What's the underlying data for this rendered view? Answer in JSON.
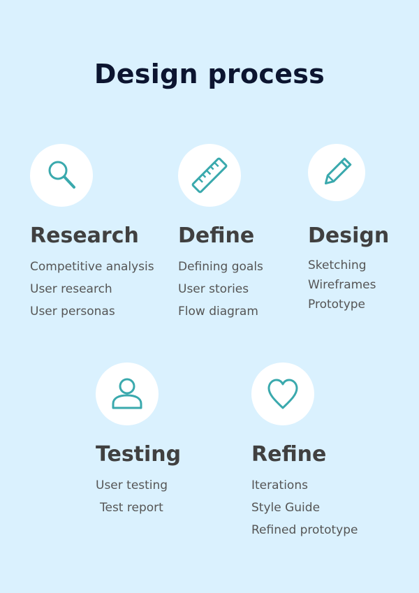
{
  "title": "Design process",
  "stages": [
    {
      "name": "Research",
      "icon": "magnifier-icon",
      "items": [
        "Competitive analysis",
        "User research",
        "User personas"
      ]
    },
    {
      "name": "Define",
      "icon": "ruler-icon",
      "items": [
        "Defining goals",
        "User stories",
        "Flow diagram"
      ]
    },
    {
      "name": "Design",
      "icon": "pencil-icon",
      "items": [
        "Sketching",
        "Wireframes",
        "Prototype"
      ]
    },
    {
      "name": "Testing",
      "icon": "user-icon",
      "items": [
        "User testing",
        "Test report"
      ]
    },
    {
      "name": "Refine",
      "icon": "heart-icon",
      "items": [
        "Iterations",
        "Style Guide",
        "Refined prototype"
      ]
    }
  ],
  "colors": {
    "background": "#daf1fe",
    "icon": "#3aa9ad",
    "title": "#0c1530",
    "heading": "#404040",
    "text": "#555555"
  }
}
